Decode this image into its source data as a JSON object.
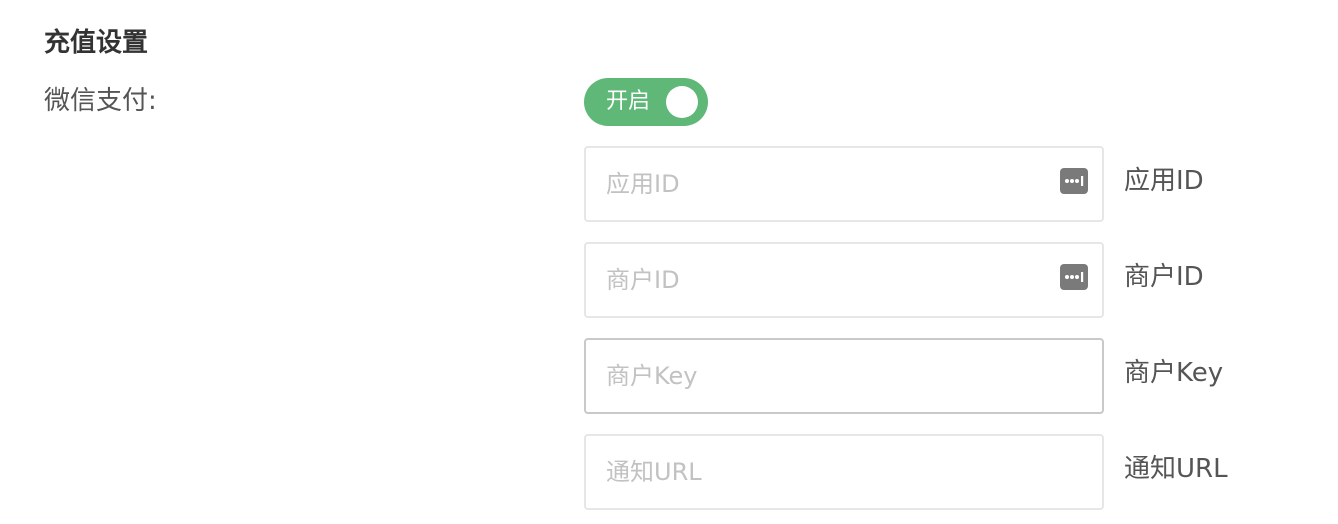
{
  "section": {
    "title": "充值设置"
  },
  "wechat_pay": {
    "label": "微信支付:",
    "toggle": {
      "state_label": "开启",
      "enabled": true,
      "color": "#5fb878"
    }
  },
  "fields": [
    {
      "placeholder": "应用ID",
      "value": "",
      "side_label": "应用ID",
      "icon": "password-key-icon"
    },
    {
      "placeholder": "商户ID",
      "value": "",
      "side_label": "商户ID",
      "icon": "password-key-icon"
    },
    {
      "placeholder": "商户Key",
      "value": "",
      "side_label": "商户Key",
      "icon": null
    },
    {
      "placeholder": "通知URL",
      "value": "",
      "side_label": "通知URL",
      "icon": null
    }
  ]
}
